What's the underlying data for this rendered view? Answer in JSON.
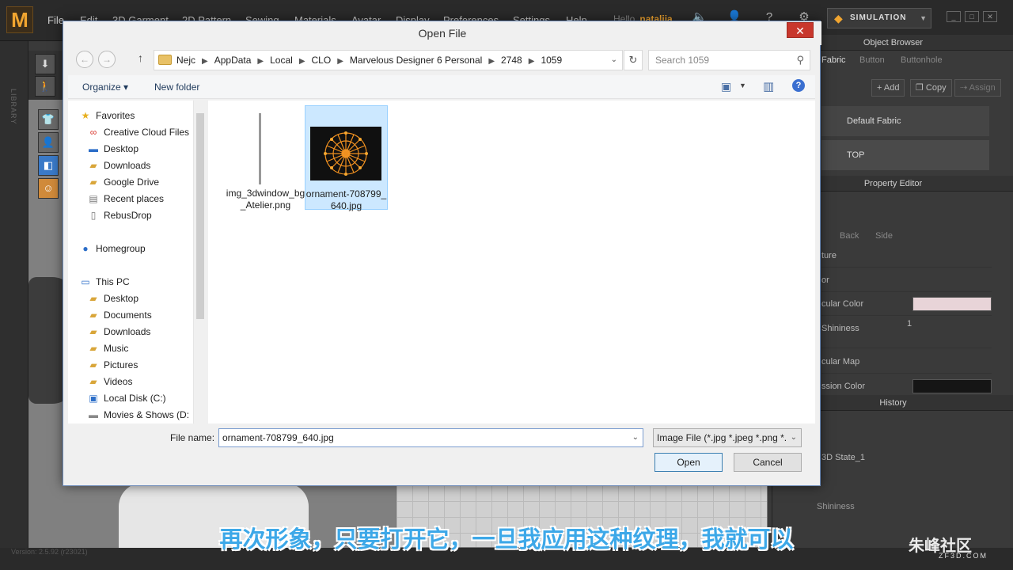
{
  "app": {
    "logo": "M",
    "menu": [
      "File",
      "Edit",
      "3D Garment",
      "2D Pattern",
      "Sewing",
      "Materials",
      "Avatar",
      "Display",
      "Preferences",
      "Settings",
      "Help"
    ],
    "greeting": "Hello",
    "user": "natalija",
    "simulation": "SIMULATION",
    "library_label": "LIBRARY",
    "version": "Version: 2.5.92",
    "build": "(r23021)"
  },
  "right": {
    "object_browser": "Object Browser",
    "tabs": [
      "Fabric",
      "Button",
      "Buttonhole"
    ],
    "add": "Add",
    "copy": "Copy",
    "assign": "Assign",
    "fabrics": [
      "Default Fabric",
      "TOP"
    ],
    "property_editor": "Property Editor",
    "prop_tabs": [
      "Back",
      "Side"
    ],
    "props": [
      "ture",
      "or",
      "cular Color",
      "Shininess",
      "cular Map",
      "ssion Color"
    ],
    "shininess_value": "1",
    "history": "History",
    "history_item": "3D State_1",
    "bottom_item": "Shininess"
  },
  "dialog": {
    "title": "Open File",
    "address": [
      "Nejc",
      "AppData",
      "Local",
      "CLO",
      "Marvelous Designer 6 Personal",
      "2748",
      "1059"
    ],
    "search_placeholder": "Search 1059",
    "organize": "Organize",
    "new_folder": "New folder",
    "favorites_header": "Favorites",
    "favorites": [
      "Creative Cloud Files",
      "Desktop",
      "Downloads",
      "Google Drive",
      "Recent places",
      "RebusDrop"
    ],
    "homegroup": "Homegroup",
    "this_pc": "This PC",
    "pc_items": [
      "Desktop",
      "Documents",
      "Downloads",
      "Music",
      "Pictures",
      "Videos",
      "Local Disk (C:)",
      "Movies & Shows (D:"
    ],
    "files": [
      {
        "name": "img_3dwindow_bg_Atelier.png"
      },
      {
        "name": "ornament-708799_640.jpg"
      }
    ],
    "file_name_label": "File name:",
    "file_name_value": "ornament-708799_640.jpg",
    "file_type": "Image File (*.jpg *.jpeg *.png *.",
    "open": "Open",
    "cancel": "Cancel"
  },
  "subtitle": "再次形象，只要打开它，一旦我应用这种纹理，我就可以",
  "watermark": "朱峰社区",
  "watermark_sub": "ZF3D.COM",
  "colors": {
    "accent": "#f1a530",
    "subtitle": "#3da8e8",
    "close": "#c8372d",
    "selection": "#cce8ff"
  }
}
